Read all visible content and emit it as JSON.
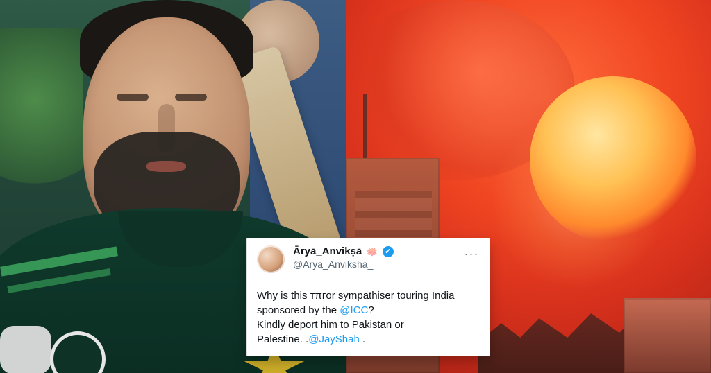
{
  "tweet": {
    "display_name": "Āryā_Anvikṣā",
    "emoji": "🪷",
    "handle": "@Arya_Anviksha_",
    "more": "···",
    "text": {
      "l1": "Why is this ᴛπᴦor sympathiser touring India",
      "l2_prefix": "sponsored by the ",
      "mention_icc": "@ICC",
      "l2_suffix": "?",
      "l3": "Kindly deport him to Pakistan or",
      "l4_prefix": "Palestine. .",
      "mention_jayshah": "@JayShah",
      "l4_suffix": " ."
    }
  },
  "icons": {
    "verified": "verified-badge-icon",
    "more": "more-icon"
  }
}
